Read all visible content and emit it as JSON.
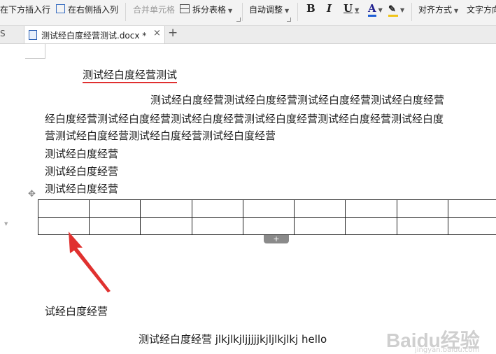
{
  "toolbar": {
    "insert_below": "在下方插入行",
    "insert_right": "在右侧插入列",
    "merge_cells": "合并单元格",
    "split_table": "拆分表格",
    "auto_adjust": "自动调整",
    "bold": "B",
    "italic": "I",
    "underline": "U",
    "font_color": "A",
    "align": "对齐方式",
    "text_direction": "文字方向"
  },
  "tabs": {
    "left_fragment": "S",
    "active_title": "测试经白度经营测试.docx *",
    "close": "×",
    "add": "+"
  },
  "doc": {
    "heading": "测试经白度经营测试",
    "para1_line1": "测试经白度经营测试经白度经营测试经白度经营测试经白度经营",
    "para1_line2": "经白度经营测试经白度经营测试经白度经营测试经白度经营测试经白度经营测试经白度",
    "para1_line3": "营测试经白度经营测试经白度经营测试经白度经营",
    "line4": "测试经白度经营",
    "line5": "测试经白度经营",
    "line6": "测试经白度经营",
    "after_table": "试经白度经营",
    "bottom_line": "测试经白度经营 jlkjlkjljjjjjkjljlkjlkj    hello"
  },
  "table": {
    "rows": 2,
    "cols": 9
  },
  "watermark": {
    "brand": "Baidu经验",
    "url": "jingyan.baidu.com"
  },
  "colors": {
    "accent_red": "#e03030",
    "font_color_bar": "#1f5fd6",
    "highlight_bar": "#f0c419"
  }
}
